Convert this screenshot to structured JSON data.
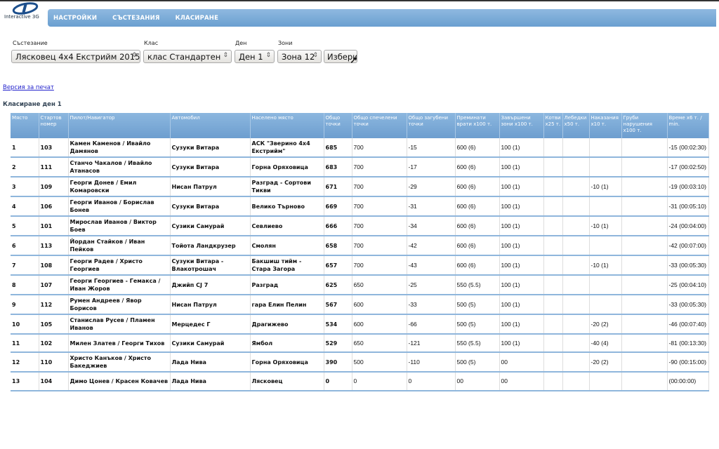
{
  "logo": {
    "text": "Interactive 3G"
  },
  "nav": [
    "НАСТРОЙКИ",
    "СЪСТЕЗАНИЯ",
    "КЛАСИРАНЕ"
  ],
  "filters": {
    "competition": {
      "label": "Състезание",
      "value": "Лясковец 4х4 Екстрийм 2015"
    },
    "class": {
      "label": "Клас",
      "value": "клас Стандартен"
    },
    "day": {
      "label": "Ден",
      "value": "Ден 1"
    },
    "zones": {
      "label": "Зони",
      "value": "Зона 12"
    },
    "submit": "Избери"
  },
  "print_link": "Версия за печат",
  "section_title": "Класиране ден 1",
  "table": {
    "headers": [
      "Място",
      "Стартов номер",
      "Пилот/Навигатор",
      "Автомобил",
      "Населено място",
      "Общо точки",
      "Общо спечелени точки",
      "Общо загубени точки",
      "Преминати врати x100 т.",
      "Завършени зони x100 т.",
      "Котви x25 т.",
      "Лебедки x50 т.",
      "Наказания x10 т.",
      "Груби нарушения x100 т.",
      "Време x6 т. / min."
    ],
    "rows": [
      [
        "1",
        "103",
        "Камен Каменов / Ивайло Дамянов",
        "Сузуки Витара",
        "АСК \"Зверино 4x4 Екстрийм\"",
        "685",
        "700",
        "-15",
        "600 (6)",
        "100 (1)",
        "",
        "",
        "",
        "",
        "-15 (00:02:30)"
      ],
      [
        "2",
        "111",
        "Станчо Чакалов / Ивайло Атанасов",
        "Сузуки Витара",
        "Горна Оряховица",
        "683",
        "700",
        "-17",
        "600 (6)",
        "100 (1)",
        "",
        "",
        "",
        "",
        "-17 (00:02:50)"
      ],
      [
        "3",
        "109",
        "Георги Донев / Емил Комаровски",
        "Нисан Патрул",
        "Разград - Сортови Тикви",
        "671",
        "700",
        "-29",
        "600 (6)",
        "100 (1)",
        "",
        "",
        "-10 (1)",
        "",
        "-19 (00:03:10)"
      ],
      [
        "4",
        "106",
        "Георги Иванов / Борислав Бонев",
        "Сузуки Витара",
        "Велико Търново",
        "669",
        "700",
        "-31",
        "600 (6)",
        "100 (1)",
        "",
        "",
        "",
        "",
        "-31 (00:05:10)"
      ],
      [
        "5",
        "101",
        "Мирослав Иванов / Виктор Боев",
        "Сузики Самурай",
        "Севлиево",
        "666",
        "700",
        "-34",
        "600 (6)",
        "100 (1)",
        "",
        "",
        "-10 (1)",
        "",
        "-24 (00:04:00)"
      ],
      [
        "6",
        "113",
        "Йордан Стайков / Иван Пейков",
        "Тойота Ландкрузер",
        "Смолян",
        "658",
        "700",
        "-42",
        "600 (6)",
        "100 (1)",
        "",
        "",
        "",
        "",
        "-42 (00:07:00)"
      ],
      [
        "7",
        "108",
        "Георги Радев / Христо Георгиев",
        "Сузуки Витара - Влакотрошач",
        "Бакшиш тийм - Стара Загора",
        "657",
        "700",
        "-43",
        "600 (6)",
        "100 (1)",
        "",
        "",
        "-10 (1)",
        "",
        "-33 (00:05:30)"
      ],
      [
        "8",
        "107",
        "Георги Георгиев - Гемакса / Иван Жоров",
        "Джийп CJ 7",
        "Разград",
        "625",
        "650",
        "-25",
        "550 (5.5)",
        "100 (1)",
        "",
        "",
        "",
        "",
        "-25 (00:04:10)"
      ],
      [
        "9",
        "112",
        "Румен Андреев / Явор Борисов",
        "Нисан Патрул",
        "гара Елин Пелин",
        "567",
        "600",
        "-33",
        "500 (5)",
        "100 (1)",
        "",
        "",
        "",
        "",
        "-33 (00:05:30)"
      ],
      [
        "10",
        "105",
        "Станислав Русев / Пламен Иванов",
        "Мерцедес Г",
        "Драгижево",
        "534",
        "600",
        "-66",
        "500 (5)",
        "100 (1)",
        "",
        "",
        "-20 (2)",
        "",
        "-46 (00:07:40)"
      ],
      [
        "11",
        "102",
        "Милен Златев / Георги Тихов",
        "Сузики Самурай",
        "Ямбол",
        "529",
        "650",
        "-121",
        "550 (5.5)",
        "100 (1)",
        "",
        "",
        "-40 (4)",
        "",
        "-81 (00:13:30)"
      ],
      [
        "12",
        "110",
        "Христо Канъков / Христо Бакеджиев",
        "Лада Нива",
        "Горна Оряховица",
        "390",
        "500",
        "-110",
        "500 (5)",
        "00",
        "",
        "",
        "-20 (2)",
        "",
        "-90 (00:15:00)"
      ],
      [
        "13",
        "104",
        "Димо Цонев / Красен Ковачев",
        "Лада Нива",
        "Лясковец",
        "0",
        "0",
        "0",
        "00",
        "00",
        "",
        "",
        "",
        "",
        "(00:00:00)"
      ]
    ]
  }
}
